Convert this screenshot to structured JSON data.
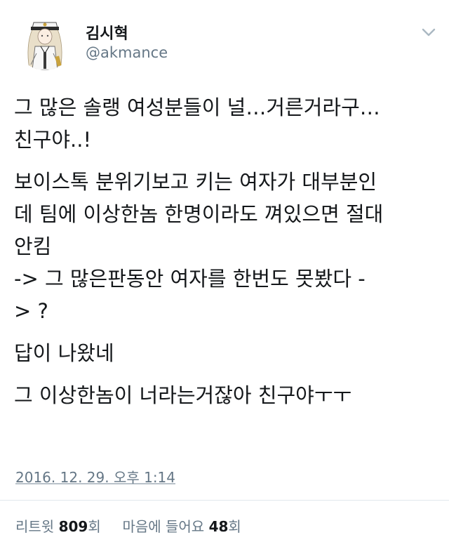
{
  "author": {
    "name": "김시혁",
    "handle": "@akmance"
  },
  "icons": {
    "menu": "chevron-down-icon",
    "avatar": "anime-character-avatar"
  },
  "tweet": {
    "paragraphs": [
      [
        "그 많은 솔랭 여성분들이 널…거른거라구…",
        "친구야..!"
      ],
      [
        "보이스톡 분위기보고 키는 여자가 대부분인",
        "데 팀에 이상한놈 한명이라도 껴있으면 절대",
        "안킴",
        "-> 그 많은판동안 여자를 한번도 못봤다 -",
        "> ?"
      ],
      [
        "답이 나왔네"
      ],
      [
        "그 이상한놈이 너라는거잖아 친구야ㅜㅜ"
      ]
    ]
  },
  "timestamp": "2016. 12. 29. 오후 1:14",
  "stats": {
    "retweet_label": "리트윗",
    "retweet_count": "809",
    "retweet_unit": "회",
    "like_label": "마음에 들어요",
    "like_count": "48",
    "like_unit": "회"
  },
  "colors": {
    "text": "#14171a",
    "secondary": "#657786",
    "divider": "#e1e8ed"
  }
}
